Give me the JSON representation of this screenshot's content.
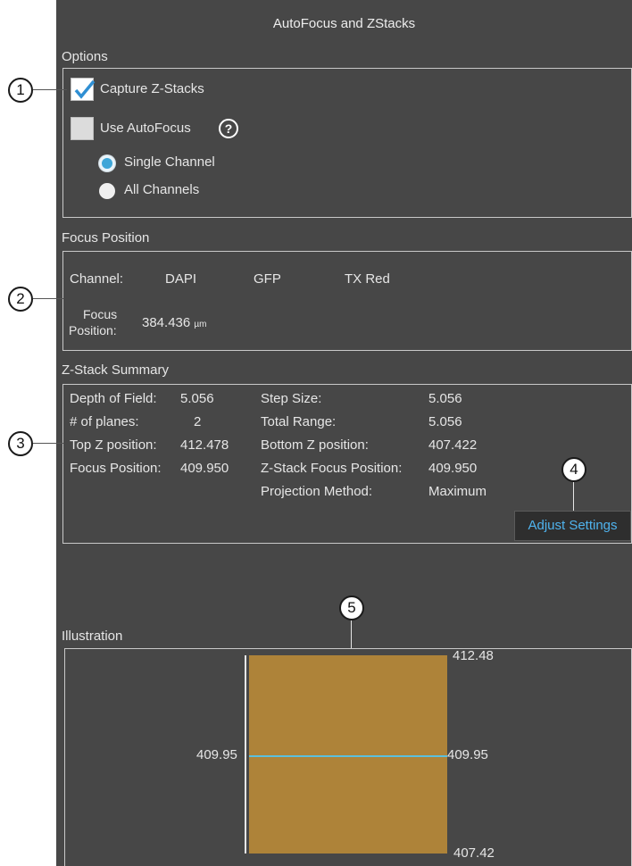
{
  "window": {
    "title": "AutoFocus and ZStacks"
  },
  "options": {
    "label": "Options",
    "capture_zstacks": {
      "label": "Capture Z-Stacks",
      "checked": true
    },
    "use_autofocus": {
      "label": "Use AutoFocus",
      "checked": false,
      "help": "?"
    },
    "mode": {
      "selected": "Single Channel",
      "options": [
        "Single Channel",
        "All Channels"
      ]
    }
  },
  "focus_position": {
    "label": "Focus Position",
    "channel_label": "Channel:",
    "channels": [
      "DAPI",
      "GFP",
      "TX Red"
    ],
    "focus_label_line1": "Focus",
    "focus_label_line2": "Position:",
    "value": "384.436",
    "unit": "µm"
  },
  "zstack_summary": {
    "label": "Z-Stack Summary",
    "left": [
      {
        "label": "Depth of Field:",
        "value": "5.056"
      },
      {
        "label": "# of planes:",
        "value": "2"
      },
      {
        "label": "Top Z position:",
        "value": "412.478"
      },
      {
        "label": "Focus Position:",
        "value": "409.950"
      }
    ],
    "right": [
      {
        "label": "Step Size:",
        "value": "5.056"
      },
      {
        "label": "Total Range:",
        "value": "5.056"
      },
      {
        "label": "Bottom Z position:",
        "value": "407.422"
      },
      {
        "label": "Z-Stack Focus Position:",
        "value": "409.950"
      },
      {
        "label": "Projection Method:",
        "value": "Maximum"
      }
    ],
    "adjust_button": "Adjust Settings"
  },
  "illustration": {
    "label": "Illustration",
    "top_value": "412.48",
    "focus_left": "409.95",
    "focus_right": "409.95",
    "bottom_value": "407.42"
  },
  "callouts": [
    "1",
    "2",
    "3",
    "4",
    "5"
  ],
  "colors": {
    "panel_bg": "#474747",
    "accent_blue": "#3ea6d8",
    "link_blue": "#4fb3ee",
    "stack_fill": "#ae8339",
    "focus_line": "#5bc0de"
  }
}
